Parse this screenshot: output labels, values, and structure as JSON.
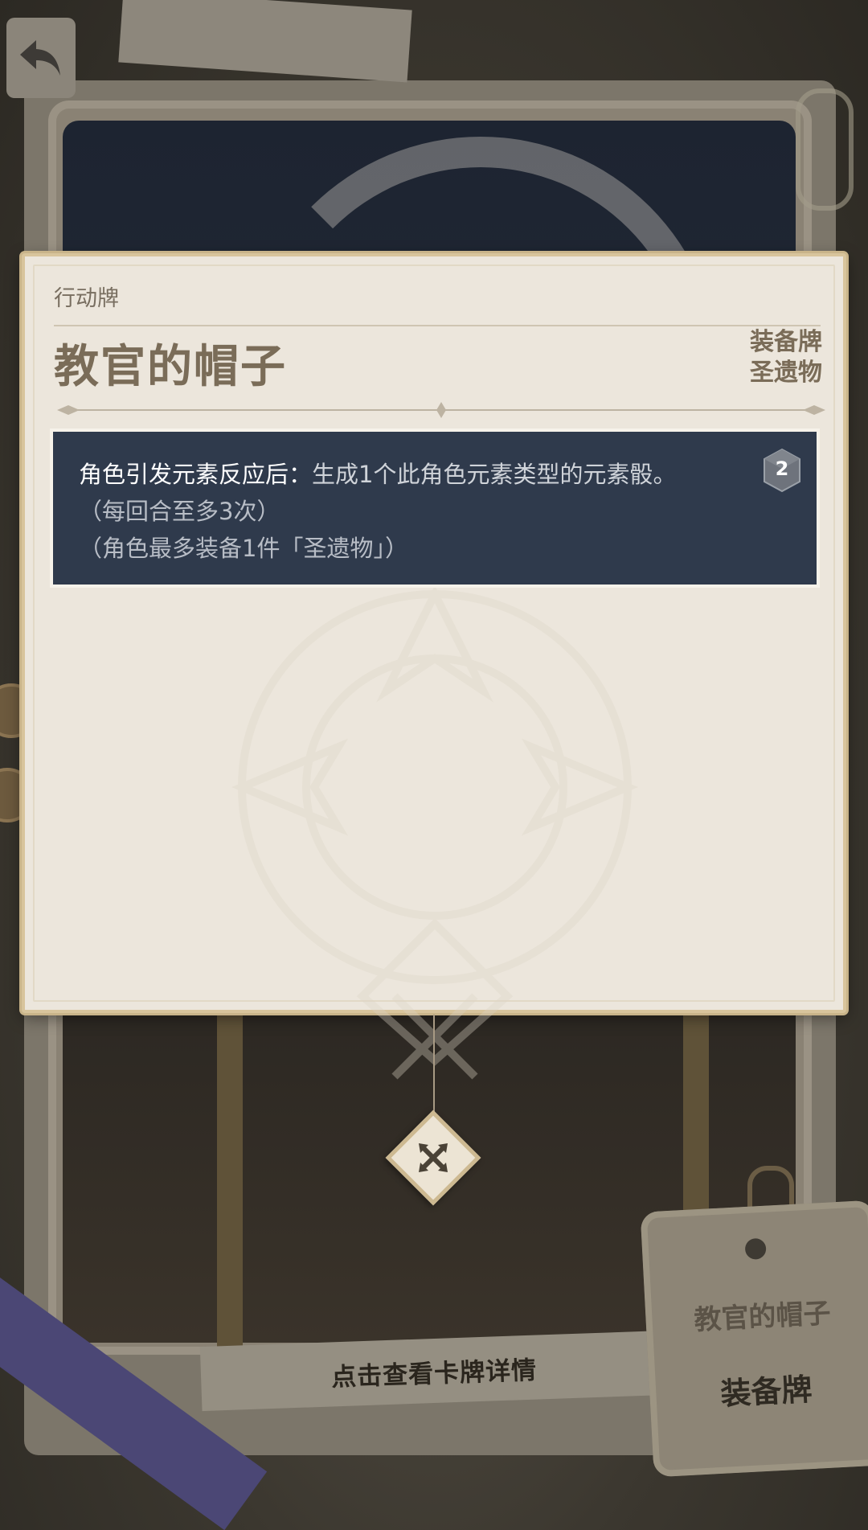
{
  "nav": {
    "back_icon": "back-arrow-icon"
  },
  "panel": {
    "category": "行动牌",
    "title": "教官的帽子",
    "tags": [
      "装备牌",
      "圣遗物"
    ],
    "cost": "2",
    "description": {
      "lead": "角色引发元素反应后：",
      "effect": "生成1个此角色元素类型的元素骰。",
      "note1": "（每回合至多3次）",
      "note2": "（角色最多装备1件「圣遗物」）"
    },
    "close_icon": "close-x-icon"
  },
  "background": {
    "hint": "点击查看卡牌详情",
    "tag_title": "教官的帽子",
    "tag_type": "装备牌"
  },
  "colors": {
    "panel_bg": "#ece6dc",
    "desc_bg": "#2f3a4c",
    "title_text": "#7a6c58",
    "border_gold": "#d8c49c"
  }
}
